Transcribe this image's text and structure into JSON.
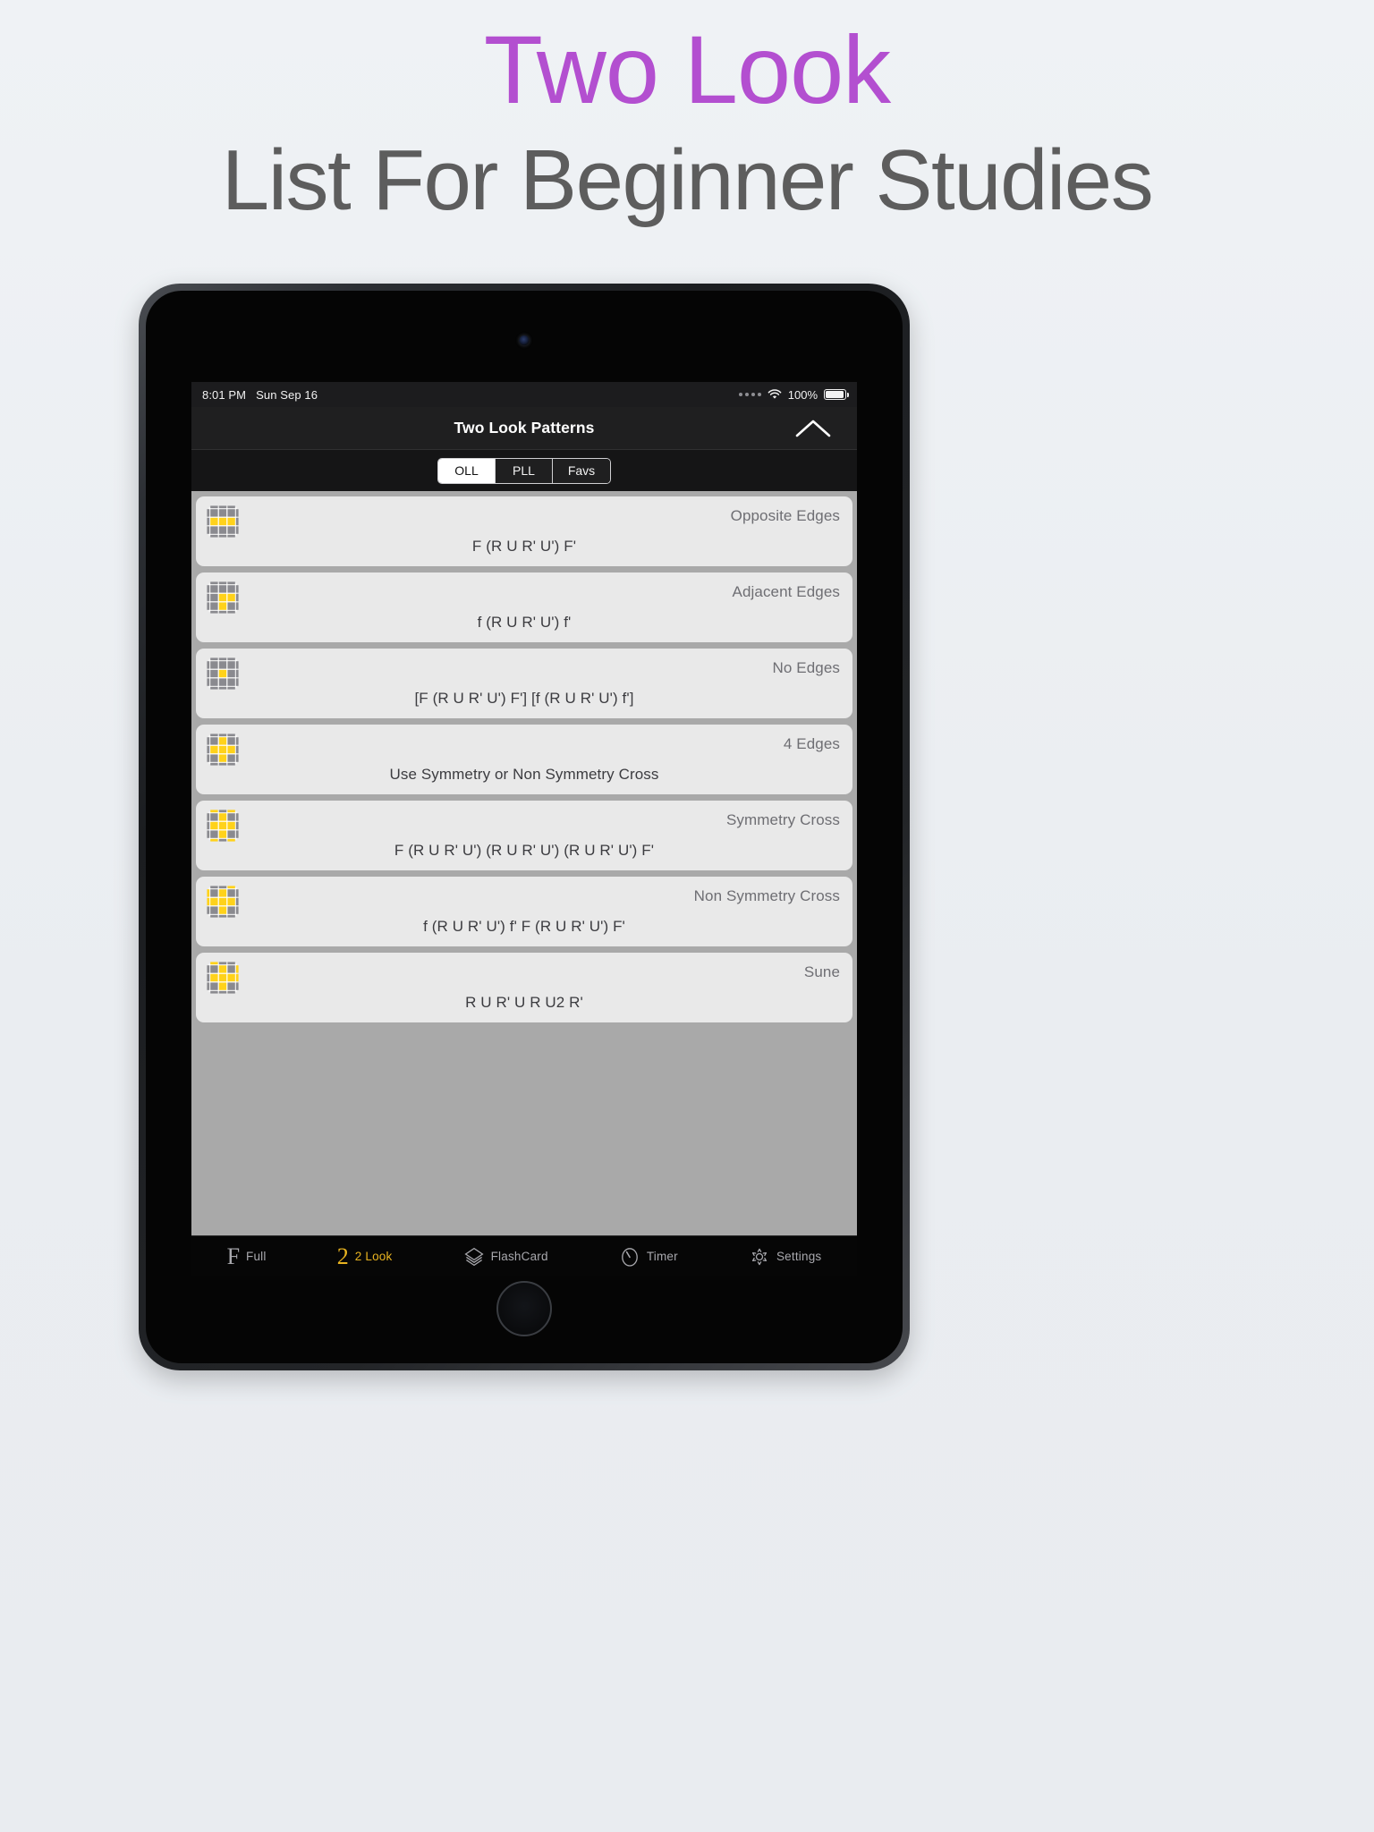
{
  "headline": {
    "line1": "Two Look",
    "line2": "List For Beginner Studies",
    "accent_color": "#b34fd0",
    "subtitle_color": "#5d5d5d"
  },
  "device": {
    "statusbar": {
      "time": "8:01 PM",
      "date": "Sun Sep 16",
      "battery_percent": "100%",
      "wifi_icon": "wifi-icon",
      "battery_icon": "battery-full-icon",
      "signal_dots_icon": "signal-dots-icon"
    }
  },
  "navbar": {
    "title": "Two Look Patterns",
    "right_icon": "chevron-up-icon"
  },
  "segmented": {
    "options": [
      {
        "label": "OLL",
        "selected": true
      },
      {
        "label": "PLL",
        "selected": false
      },
      {
        "label": "Favs",
        "selected": false
      }
    ]
  },
  "list": {
    "rows": [
      {
        "title": "Opposite Edges",
        "algorithm": "F (R U R' U') F'",
        "cube": {
          "faces": [
            "gray",
            "gray",
            "gray",
            "yellow",
            "yellow",
            "yellow",
            "gray",
            "gray",
            "gray"
          ],
          "edges": {
            "top": [
              0,
              0,
              0
            ],
            "bottom": [
              0,
              0,
              0
            ],
            "left": [
              0,
              0,
              0
            ],
            "right": [
              0,
              0,
              0
            ]
          }
        }
      },
      {
        "title": "Adjacent Edges",
        "algorithm": "f (R U R' U') f'",
        "cube": {
          "faces": [
            "gray",
            "gray",
            "gray",
            "gray",
            "yellow",
            "yellow",
            "gray",
            "yellow",
            "gray"
          ],
          "edges": {
            "top": [
              0,
              0,
              0
            ],
            "bottom": [
              0,
              0,
              0
            ],
            "left": [
              0,
              0,
              0
            ],
            "right": [
              0,
              0,
              0
            ]
          }
        }
      },
      {
        "title": "No Edges",
        "algorithm": "[F (R U R' U') F'] [f (R U R' U') f']",
        "cube": {
          "faces": [
            "gray",
            "gray",
            "gray",
            "gray",
            "yellow",
            "gray",
            "gray",
            "gray",
            "gray"
          ],
          "edges": {
            "top": [
              0,
              0,
              0
            ],
            "bottom": [
              0,
              0,
              0
            ],
            "left": [
              0,
              0,
              0
            ],
            "right": [
              0,
              0,
              0
            ]
          }
        }
      },
      {
        "title": "4 Edges",
        "algorithm": "Use Symmetry or Non Symmetry Cross",
        "cube": {
          "faces": [
            "gray",
            "yellow",
            "gray",
            "yellow",
            "yellow",
            "yellow",
            "gray",
            "yellow",
            "gray"
          ],
          "edges": {
            "top": [
              0,
              0,
              0
            ],
            "bottom": [
              0,
              0,
              0
            ],
            "left": [
              0,
              0,
              0
            ],
            "right": [
              0,
              0,
              0
            ]
          }
        }
      },
      {
        "title": "Symmetry Cross",
        "algorithm": "F (R U R' U') (R U R' U') (R U R' U') F'",
        "cube": {
          "faces": [
            "gray",
            "yellow",
            "gray",
            "yellow",
            "yellow",
            "yellow",
            "gray",
            "yellow",
            "gray"
          ],
          "edges": {
            "top": [
              1,
              0,
              1
            ],
            "bottom": [
              1,
              0,
              1
            ],
            "left": [
              0,
              0,
              0
            ],
            "right": [
              0,
              0,
              0
            ]
          }
        }
      },
      {
        "title": "Non Symmetry Cross",
        "algorithm": "f (R U R' U') f' F (R U R' U') F'",
        "cube": {
          "faces": [
            "gray",
            "yellow",
            "gray",
            "yellow",
            "yellow",
            "yellow",
            "gray",
            "yellow",
            "gray"
          ],
          "edges": {
            "top": [
              0,
              0,
              1
            ],
            "bottom": [
              0,
              0,
              0
            ],
            "left": [
              1,
              1,
              0
            ],
            "right": [
              0,
              0,
              0
            ]
          }
        }
      },
      {
        "title": "Sune",
        "algorithm": "R U R' U R U2 R'",
        "cube": {
          "faces": [
            "gray",
            "yellow",
            "gray",
            "yellow",
            "yellow",
            "yellow",
            "gray",
            "yellow",
            "gray"
          ],
          "edges": {
            "top": [
              1,
              0,
              0
            ],
            "bottom": [
              0,
              0,
              0
            ],
            "left": [
              0,
              0,
              0
            ],
            "right": [
              1,
              1,
              0
            ]
          }
        }
      }
    ],
    "colors": {
      "yellow": "#FFD21A",
      "gray": "#8a8a8f",
      "row_bg": "#e9e9e9",
      "list_bg": "#a9a9a9"
    }
  },
  "tabbar": {
    "items": [
      {
        "label": "Full",
        "icon": "full-f-icon",
        "glyph": "F",
        "active": false
      },
      {
        "label": "2 Look",
        "icon": "two-look-icon",
        "glyph": "2",
        "active": true
      },
      {
        "label": "FlashCard",
        "icon": "flashcard-layers-icon",
        "glyph": "",
        "active": false
      },
      {
        "label": "Timer",
        "icon": "timer-stopwatch-icon",
        "glyph": "",
        "active": false
      },
      {
        "label": "Settings",
        "icon": "gear-icon",
        "glyph": "",
        "active": false
      }
    ],
    "active_color": "#e8b320",
    "inactive_color": "#a8a8ad"
  }
}
